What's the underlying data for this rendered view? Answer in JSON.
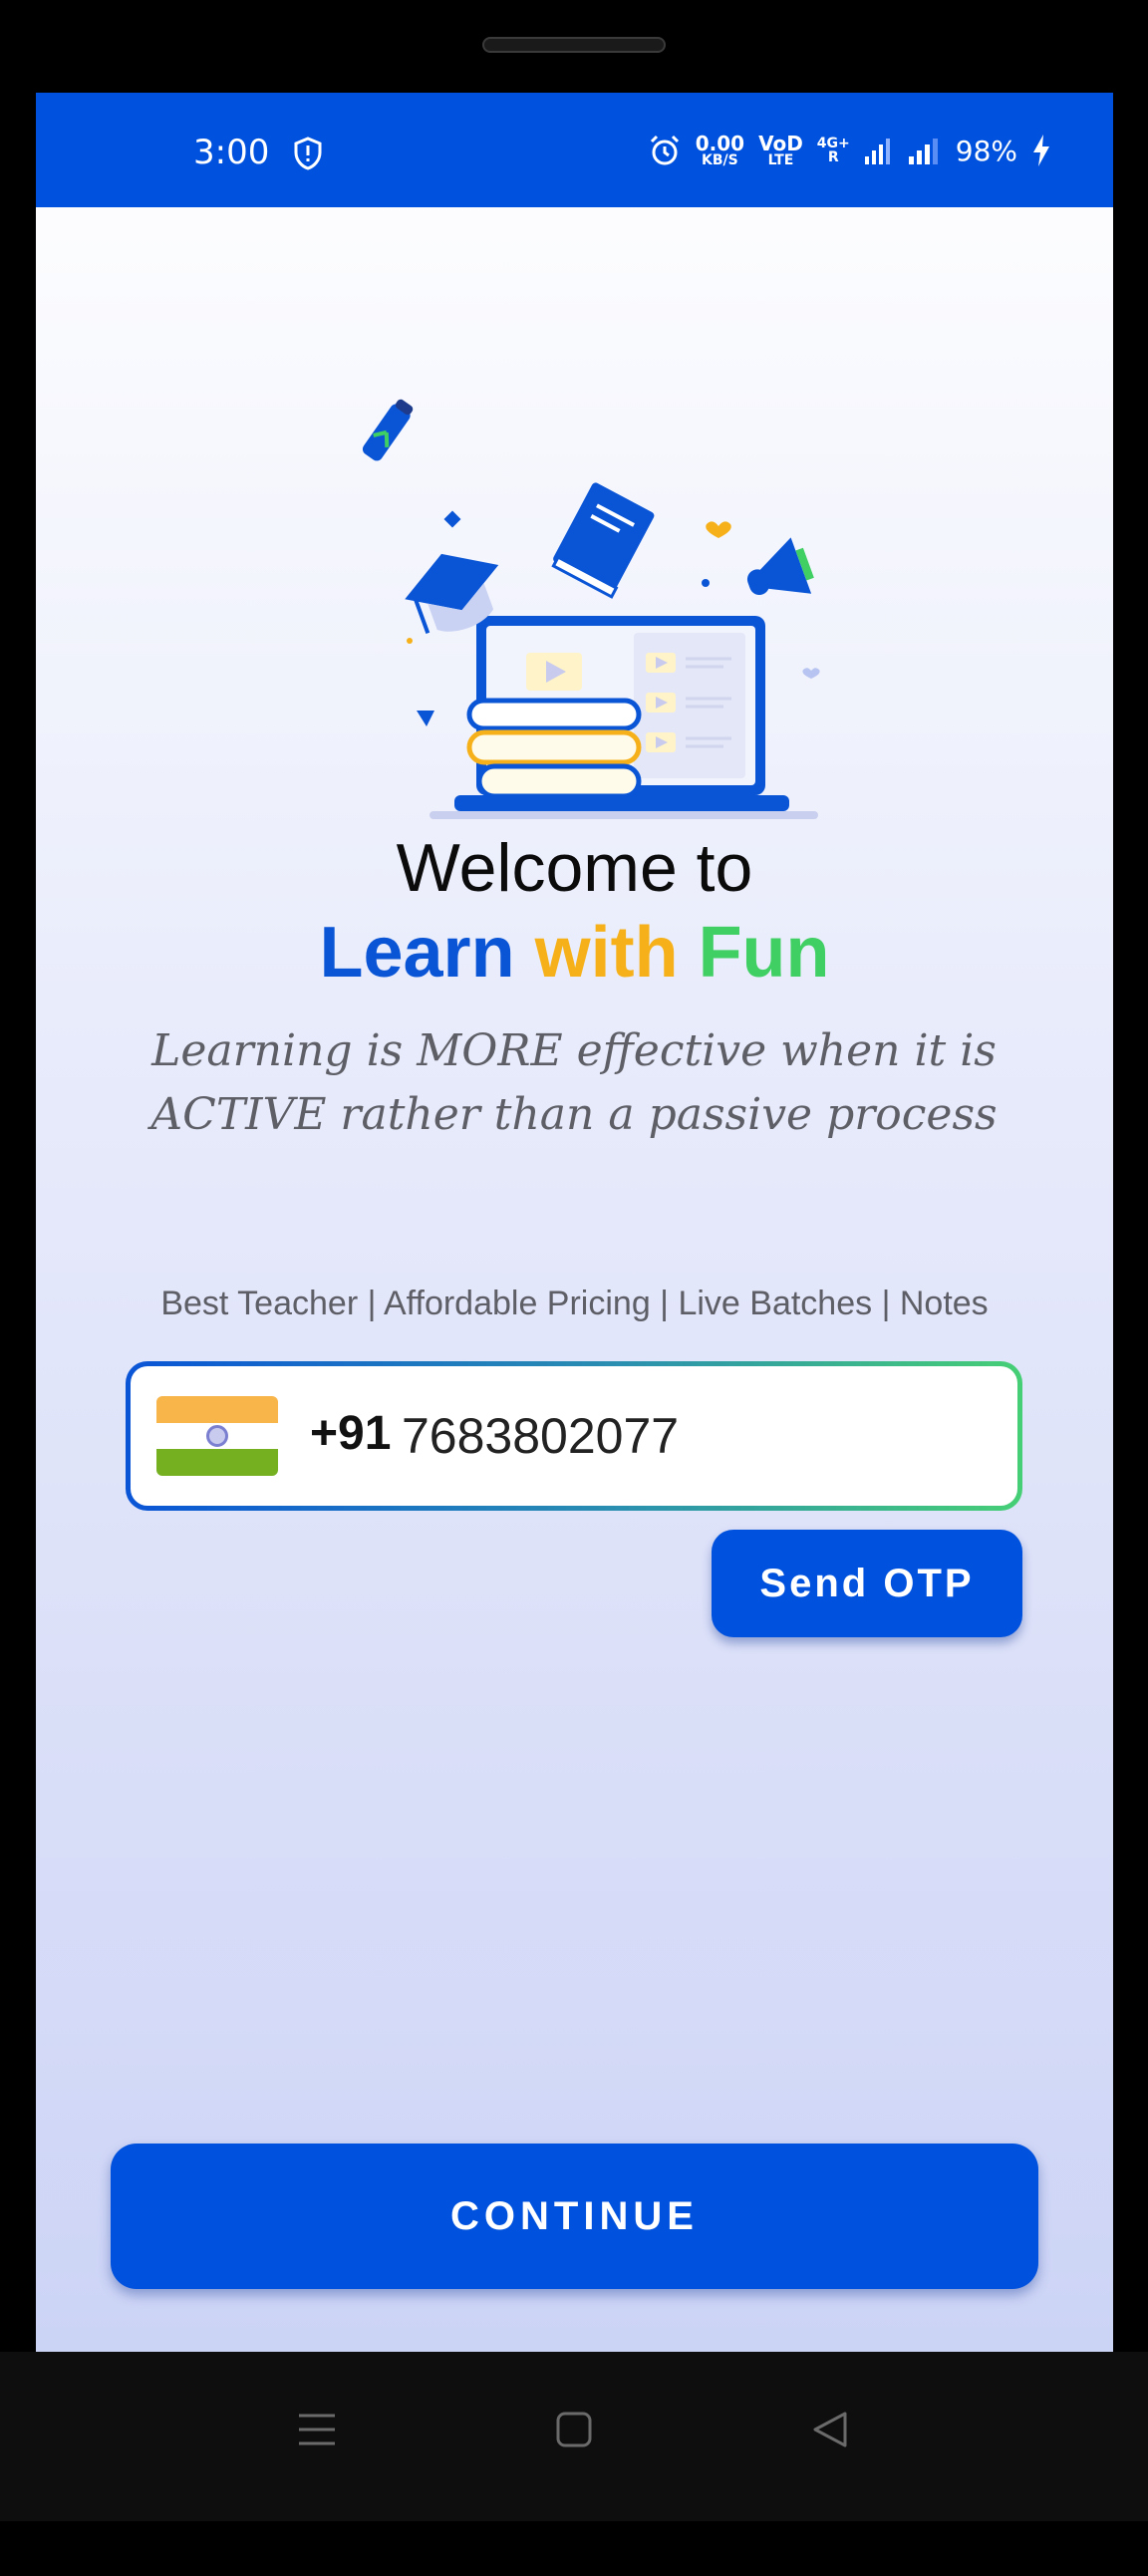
{
  "status_bar": {
    "time": "3:00",
    "net_speed_value": "0.00",
    "net_speed_unit": "KB/S",
    "volte_top": "VoD",
    "volte_bottom": "LTE",
    "network_top": "4G+",
    "network_bottom": "R",
    "battery": "98%",
    "icons": [
      "shield-icon",
      "alarm-icon",
      "signal-icon",
      "battery-charging-icon"
    ]
  },
  "welcome": {
    "line1": "Welcome to",
    "brand_learn": "Learn",
    "brand_with": "with",
    "brand_fun": "Fun"
  },
  "tagline": "Learning is MORE effective when it is ACTIVE rather than a passive process",
  "features": "Best Teacher | Affordable Pricing | Live Batches | Notes",
  "phone": {
    "country_code": "+91",
    "number": "7683802077",
    "flag": "india-flag"
  },
  "buttons": {
    "send_otp": "Send OTP",
    "continue": "CONTINUE"
  },
  "nav": {
    "icons": [
      "menu-icon",
      "home-icon",
      "back-icon"
    ]
  },
  "colors": {
    "primary": "#0052de",
    "brand_learn": "#0a55d6",
    "brand_with": "#f6b11a",
    "brand_fun": "#3fcf63"
  }
}
